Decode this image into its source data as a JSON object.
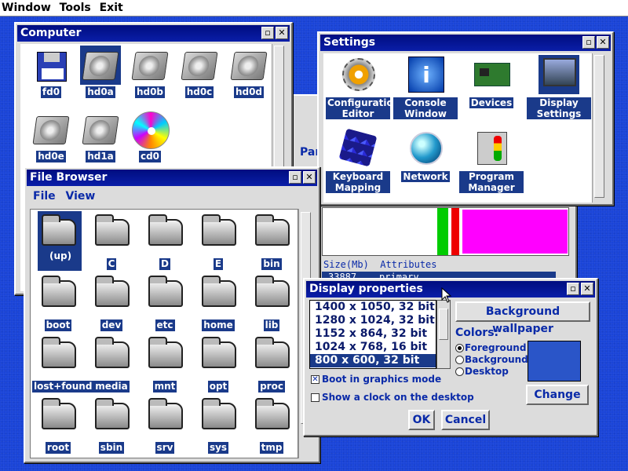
{
  "menubar": {
    "items": [
      "Window",
      "Tools",
      "Exit"
    ]
  },
  "computer": {
    "title": "Computer",
    "icons": [
      {
        "label": "fd0",
        "type": "floppy",
        "selected": false
      },
      {
        "label": "hd0a",
        "type": "disk",
        "selected": true
      },
      {
        "label": "hd0b",
        "type": "disk",
        "selected": false
      },
      {
        "label": "hd0c",
        "type": "disk",
        "selected": false
      },
      {
        "label": "hd0d",
        "type": "disk",
        "selected": false
      },
      {
        "label": "hd0e",
        "type": "disk",
        "selected": false
      },
      {
        "label": "hd1a",
        "type": "disk",
        "selected": false
      },
      {
        "label": "cd0",
        "type": "cd",
        "selected": false
      }
    ]
  },
  "background_window": {
    "partial_label": "Par",
    "size_header": "Size(Mb)",
    "attributes_header": "Attributes",
    "row_size": "33887",
    "row_attr": "primary"
  },
  "settings": {
    "title": "Settings",
    "icons": [
      {
        "label": "Configuration Editor",
        "type": "gear"
      },
      {
        "label": "Console Window",
        "type": "info"
      },
      {
        "label": "Devices",
        "type": "card"
      },
      {
        "label": "Display Settings",
        "type": "monitor"
      },
      {
        "label": "Keyboard Mapping",
        "type": "cubes"
      },
      {
        "label": "Network",
        "type": "globe"
      },
      {
        "label": "Program Manager",
        "type": "traffic"
      }
    ]
  },
  "file_browser": {
    "title": "File Browser",
    "menu": [
      "File",
      "View"
    ],
    "folders": [
      "(up)",
      "C",
      "D",
      "E",
      "bin",
      "boot",
      "dev",
      "etc",
      "home",
      "lib",
      "lost+found",
      "media",
      "mnt",
      "opt",
      "proc",
      "root",
      "sbin",
      "srv",
      "sys",
      "tmp"
    ]
  },
  "display_properties": {
    "title": "Display properties",
    "resolutions": [
      "1400 x 1050, 32 bit",
      "1280 x 1024, 32 bit",
      "1152 x 864, 32 bit",
      "1024 x 768, 16 bit",
      "800 x 600, 32 bit"
    ],
    "selected_index": 4,
    "background_wallpaper": "Background wallpaper",
    "colors_label": "Colors:",
    "color_options": [
      "Foreground",
      "Background",
      "Desktop"
    ],
    "boot_graphics": "Boot in graphics mode",
    "show_clock": "Show a clock on the desktop",
    "change": "Change",
    "ok": "OK",
    "cancel": "Cancel",
    "swatch_color": "#2a55c8"
  },
  "title_buttons": {
    "restore": "▫",
    "close": "✕"
  }
}
